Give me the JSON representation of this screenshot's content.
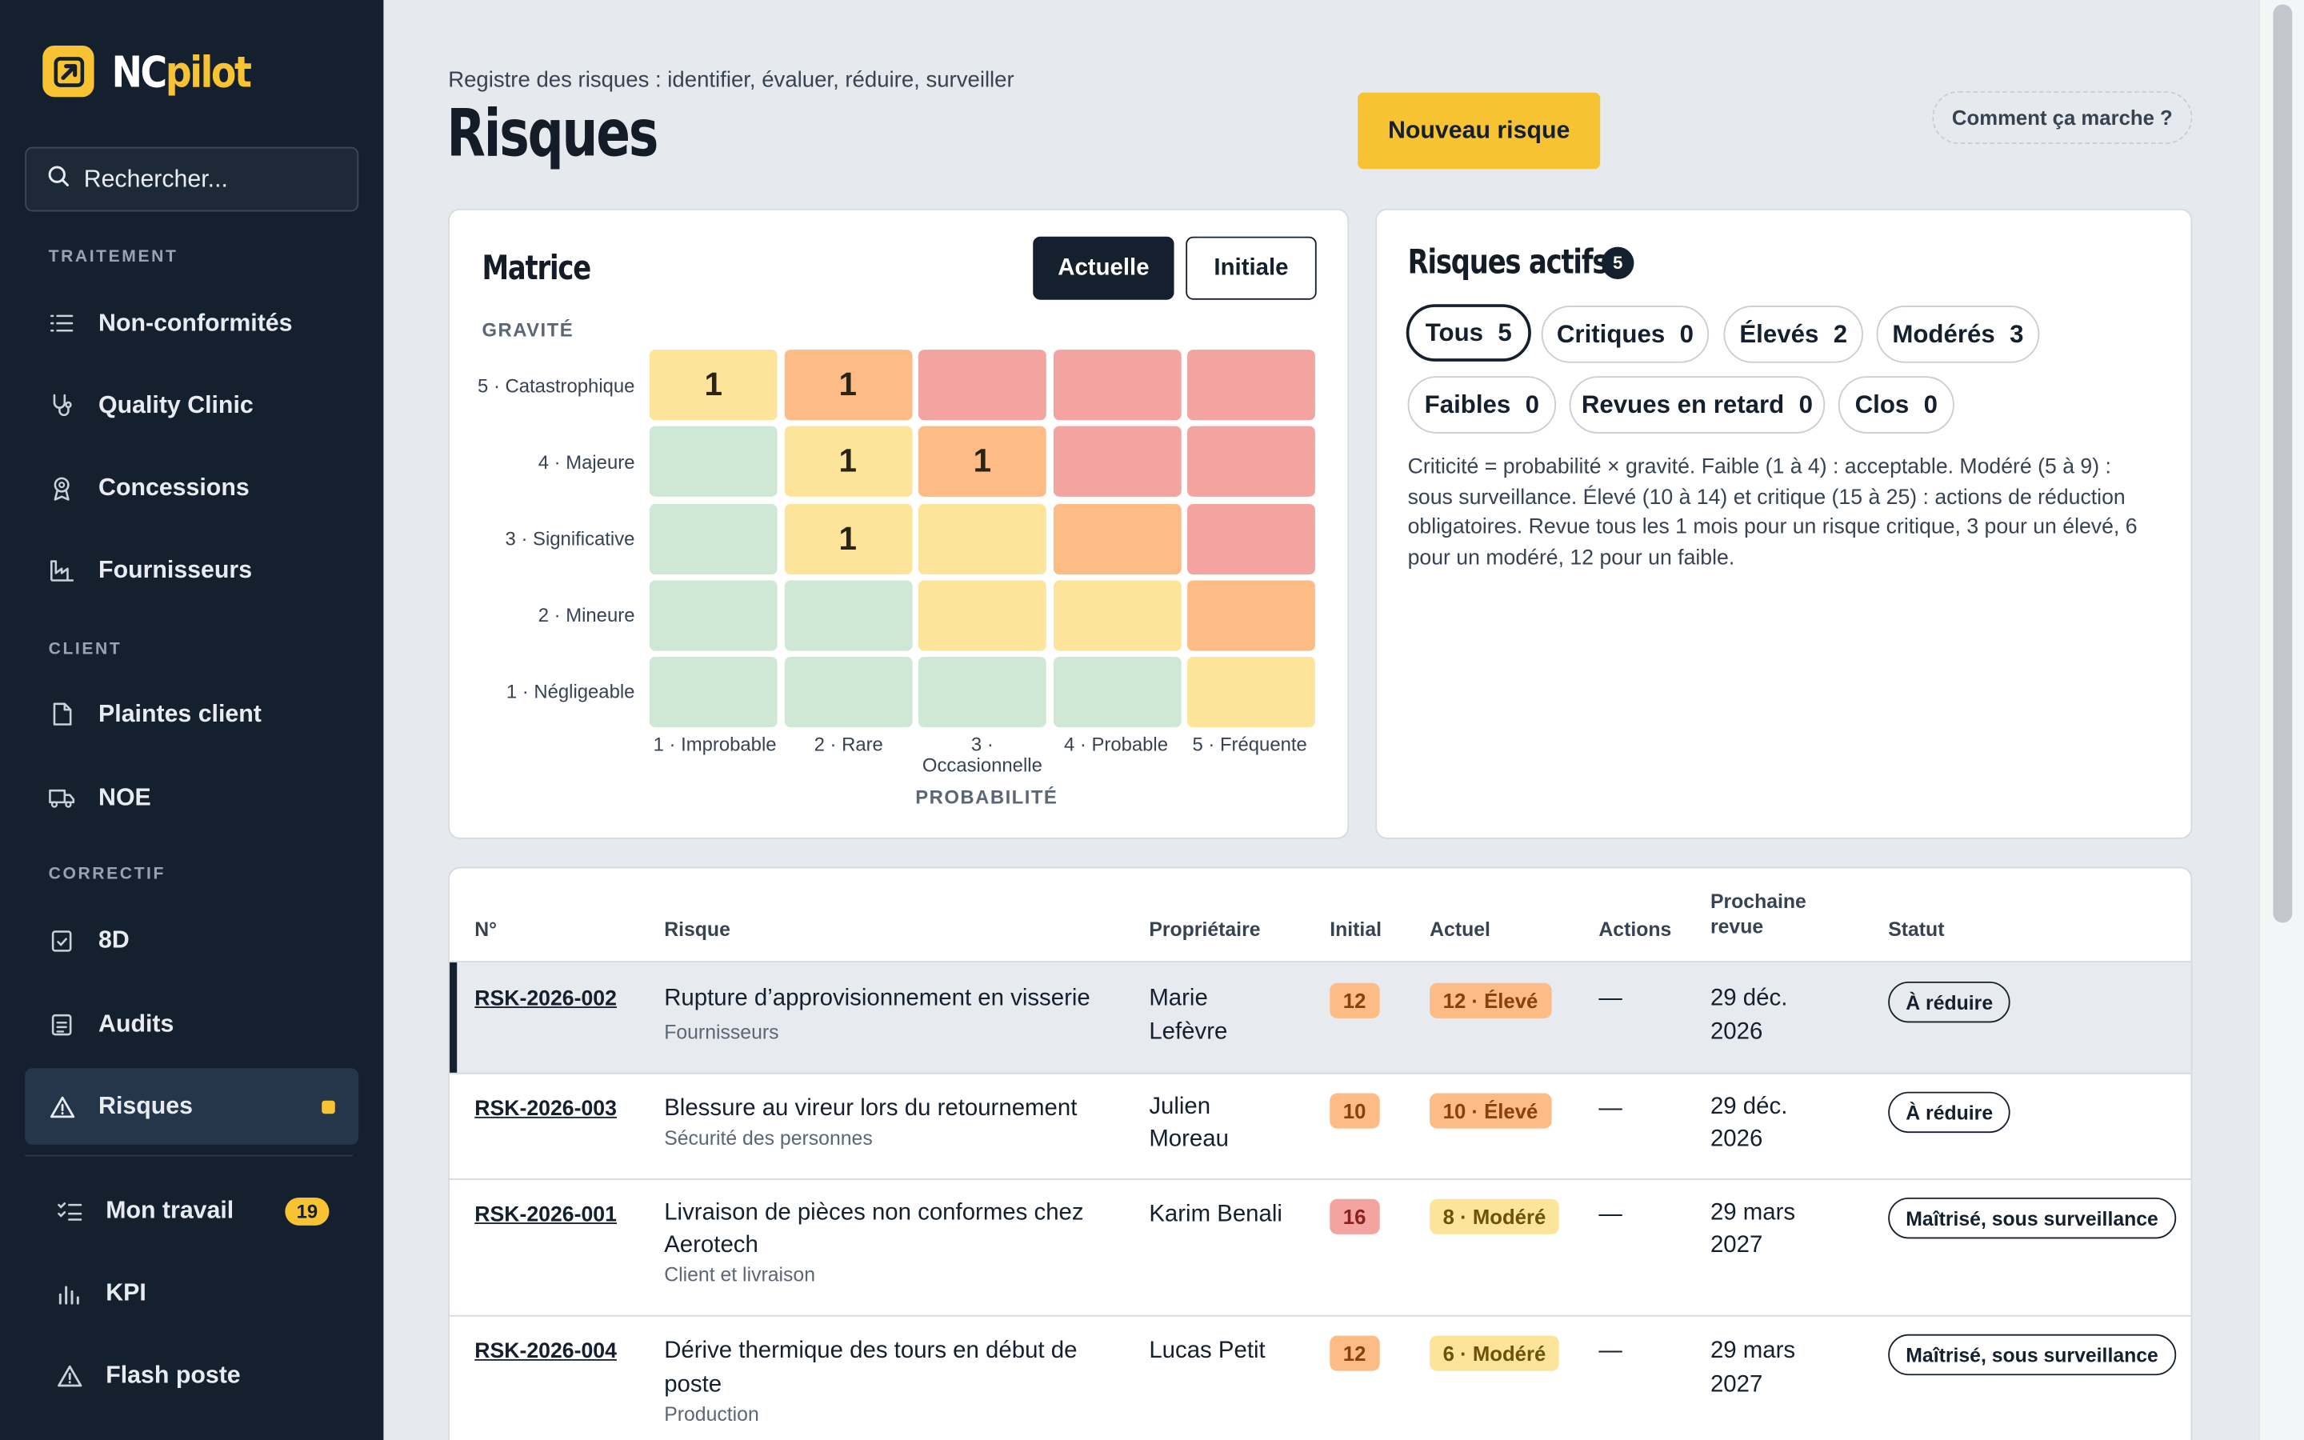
{
  "app": {
    "logo_nc": "NC",
    "logo_pilot": "pilot"
  },
  "sidebar": {
    "search_placeholder": "Rechercher...",
    "sections": {
      "traitement": "TRAITEMENT",
      "client": "CLIENT",
      "correctif": "CORRECTIF"
    },
    "items": {
      "nonconformites": "Non-conformités",
      "quality_clinic": "Quality Clinic",
      "concessions": "Concessions",
      "fournisseurs": "Fournisseurs",
      "plaintes": "Plaintes client",
      "noe": "NOE",
      "eight_d": "8D",
      "audits": "Audits",
      "risques": "Risques",
      "mon_travail": "Mon travail",
      "mon_travail_badge": "19",
      "kpi": "KPI",
      "flash": "Flash poste"
    },
    "accent": "#f7c333"
  },
  "page": {
    "subtitle": "Registre des risques : identifier, évaluer, réduire, surveiller",
    "title": "Risques",
    "new_button": "Nouveau risque",
    "help_button": "Comment ça marche ?"
  },
  "matrix": {
    "title": "Matrice",
    "toggle_current": "Actuelle",
    "toggle_initial": "Initiale",
    "y_axis_title": "GRAVITÉ",
    "x_axis_title": "PROBABILITÉ",
    "rows": [
      "5 · Catastrophique",
      "4 · Majeure",
      "3 · Significative",
      "2 · Mineure",
      "1 · Négligeable"
    ],
    "cols": [
      "1 · Improbable",
      "2 · Rare",
      "3 · Occasionnelle",
      "4 · Probable",
      "5 · Fréquente"
    ],
    "counts": [
      [
        "1",
        "1",
        "",
        "",
        ""
      ],
      [
        "",
        "1",
        "1",
        "",
        ""
      ],
      [
        "",
        "1",
        "",
        "",
        ""
      ],
      [
        "",
        "",
        "",
        "",
        ""
      ],
      [
        "",
        "",
        "",
        "",
        ""
      ]
    ],
    "colors": {
      "low": "#cfe8d6",
      "moderate": "#fde49b",
      "high": "#fdbb85",
      "critical": "#f3a3a0"
    }
  },
  "active": {
    "title": "Risques actifs",
    "count": "5",
    "chips": [
      {
        "label": "Tous",
        "n": "5"
      },
      {
        "label": "Critiques",
        "n": "0"
      },
      {
        "label": "Élevés",
        "n": "2"
      },
      {
        "label": "Modérés",
        "n": "3"
      },
      {
        "label": "Faibles",
        "n": "0"
      },
      {
        "label": "Revues en retard",
        "n": "0"
      },
      {
        "label": "Clos",
        "n": "0"
      }
    ],
    "description": "Criticité = probabilité × gravité. Faible (1 à 4) : acceptable. Modéré (5 à 9) : sous surveillance. Élevé (10 à 14) et critique (15 à 25) : actions de réduction obligatoires. Revue tous les 1 mois pour un risque critique, 3 pour un élevé, 6 pour un modéré, 12 pour un faible."
  },
  "table": {
    "headers": {
      "id": "N°",
      "risk": "Risque",
      "owner": "Propriétaire",
      "initial": "Initial",
      "current": "Actuel",
      "actions": "Actions",
      "next_review": "Prochaine revue",
      "status": "Statut"
    },
    "rows": [
      {
        "id": "RSK-2026-002",
        "risk": "Rupture d’approvisionnement en visserie",
        "category": "Fournisseurs",
        "owner": "Marie Lefèvre",
        "initial": "12",
        "current": "12 · Élevé",
        "actions": "—",
        "next_review": "29 déc. 2026",
        "status": "À réduire"
      },
      {
        "id": "RSK-2026-003",
        "risk": "Blessure au vireur lors du retournement",
        "category": "Sécurité des personnes",
        "owner": "Julien Moreau",
        "initial": "10",
        "current": "10 · Élevé",
        "actions": "—",
        "next_review": "29 déc. 2026",
        "status": "À réduire"
      },
      {
        "id": "RSK-2026-001",
        "risk": "Livraison de pièces non conformes chez Aerotech",
        "category": "Client et livraison",
        "owner": "Karim Benali",
        "initial": "16",
        "current": "8 · Modéré",
        "actions": "—",
        "next_review": "29 mars 2027",
        "status": "Maîtrisé, sous surveillance"
      },
      {
        "id": "RSK-2026-004",
        "risk": "Dérive thermique des tours en début de poste",
        "category": "Production",
        "owner": "Lucas Petit",
        "initial": "12",
        "current": "6 · Modéré",
        "actions": "—",
        "next_review": "29 mars 2027",
        "status": "Maîtrisé, sous surveillance"
      }
    ]
  }
}
